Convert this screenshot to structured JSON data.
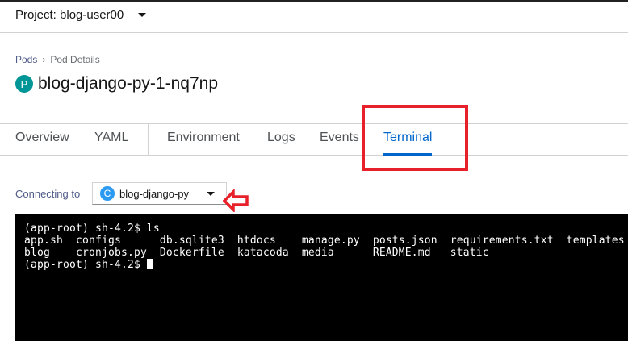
{
  "header": {
    "project_label": "Project: blog-user00"
  },
  "breadcrumb": {
    "items": [
      "Pods",
      "Pod Details"
    ]
  },
  "page": {
    "badge": "P",
    "title": "blog-django-py-1-nq7np"
  },
  "tabs": [
    {
      "label": "Overview"
    },
    {
      "label": "YAML"
    },
    {
      "label": "Environment"
    },
    {
      "label": "Logs"
    },
    {
      "label": "Events"
    },
    {
      "label": "Terminal",
      "active": true
    }
  ],
  "connect": {
    "label": "Connecting to",
    "badge": "C",
    "container": "blog-django-py"
  },
  "terminal": {
    "lines": [
      "(app-root) sh-4.2$ ls",
      "app.sh  configs      db.sqlite3  htdocs    manage.py  posts.json  requirements.txt  templates",
      "blog    cronjobs.py  Dockerfile  katacoda  media      README.md   static",
      "(app-root) sh-4.2$ "
    ]
  },
  "colors": {
    "accent": "#0066cc",
    "annotation": "#e8202a",
    "pod_badge": "#009596",
    "container_badge": "#2b9af3"
  }
}
